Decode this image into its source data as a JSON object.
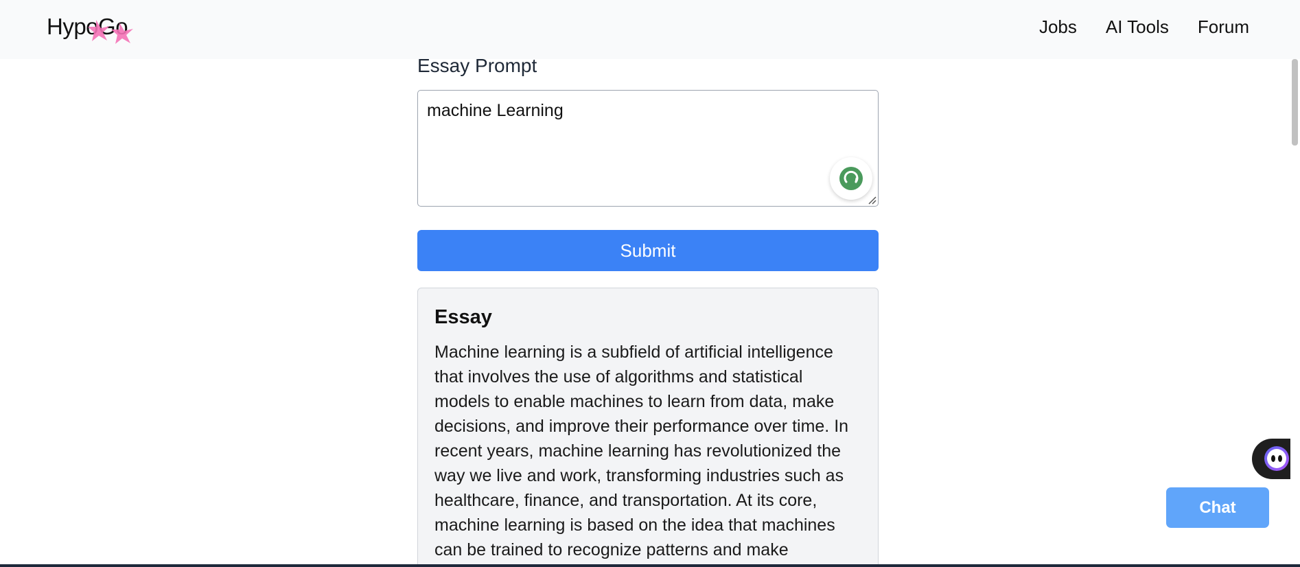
{
  "header": {
    "logo": "HypoGo",
    "nav": [
      "Jobs",
      "AI Tools",
      "Forum"
    ]
  },
  "prompt": {
    "label": "Essay Prompt",
    "value": "machine Learning"
  },
  "submit_label": "Submit",
  "essay": {
    "title": "Essay",
    "text": "Machine learning is a subfield of artificial intelligence that involves the use of algorithms and statistical models to enable machines to learn from data, make decisions, and improve their performance over time. In recent years, machine learning has revolutionized the way we live and work, transforming industries such as healthcare, finance, and transportation. At its core, machine learning is based on the idea that machines can be trained to recognize patterns and make"
  },
  "chat_label": "Chat",
  "colors": {
    "accent": "#3b82f6",
    "chat": "#60a5fa",
    "logo_stars": "#f472b6",
    "grammar": "#4a9a5c"
  },
  "icons": {
    "grammar": "grammar-assistant-icon",
    "bot": "chat-bot-icon"
  }
}
